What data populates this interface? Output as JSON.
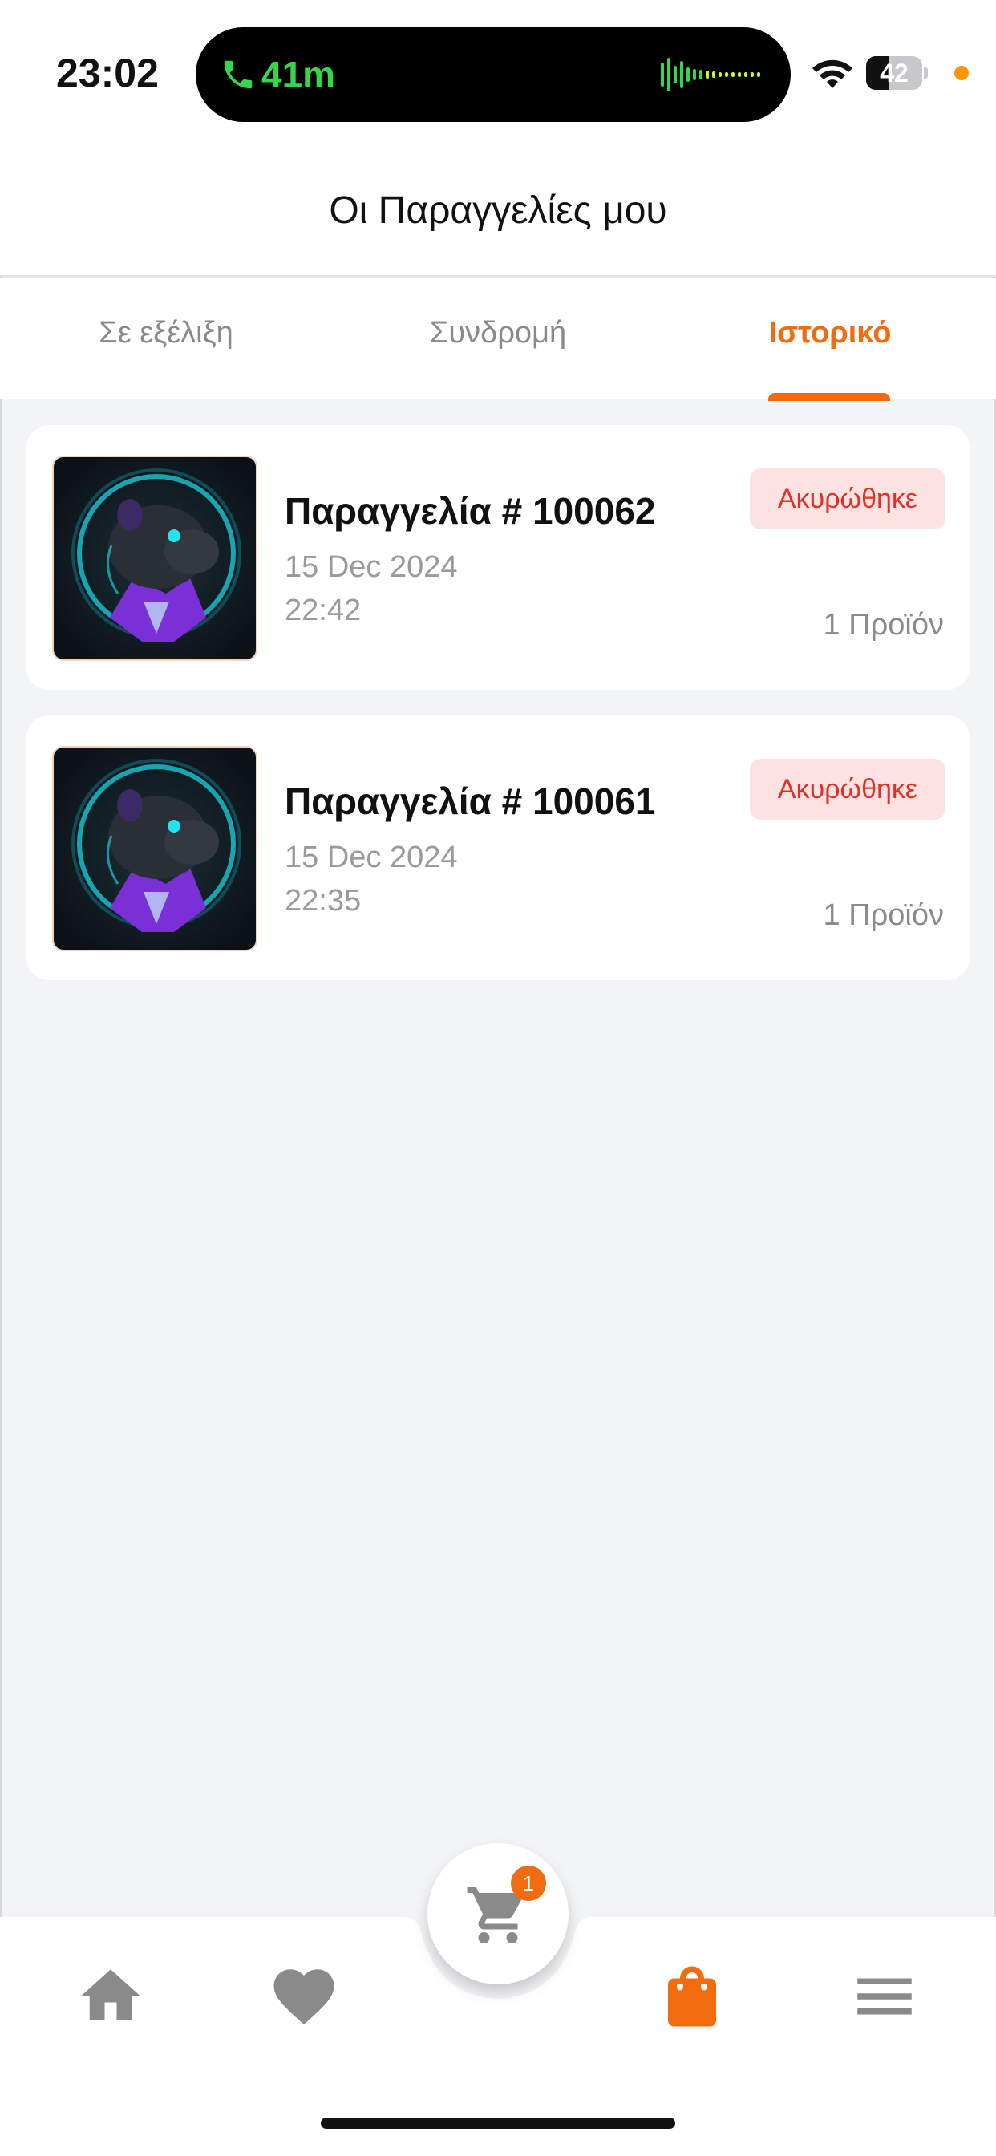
{
  "status_bar": {
    "time": "23:02",
    "call_duration": "41m",
    "battery_level": "42",
    "battery_fraction": 0.42,
    "icons": [
      "phone-icon",
      "waveform-icon",
      "wifi-icon",
      "battery-icon",
      "privacy-dot"
    ]
  },
  "header": {
    "title": "Οι Παραγγελίες μου"
  },
  "tabs": [
    {
      "label": "Σε εξέλιξη",
      "active": false
    },
    {
      "label": "Συνδρομή",
      "active": false
    },
    {
      "label": "Ιστορικό",
      "active": true
    }
  ],
  "orders": [
    {
      "title": "Παραγγελία # 100062",
      "date": "15 Dec 2024",
      "time": "22:42",
      "status": "Ακυρώθηκε",
      "items": "1 Προϊόν",
      "image": "capybara-product-image"
    },
    {
      "title": "Παραγγελία # 100061",
      "date": "15 Dec 2024",
      "time": "22:35",
      "status": "Ακυρώθηκε",
      "items": "1 Προϊόν",
      "image": "capybara-product-image"
    }
  ],
  "bottom_nav": {
    "cart_badge": "1",
    "items": [
      {
        "icon": "home-icon",
        "active": false
      },
      {
        "icon": "heart-icon",
        "active": false
      },
      {
        "icon": "cart-icon",
        "active": false
      },
      {
        "icon": "shopping-bag-icon",
        "active": true
      },
      {
        "icon": "menu-icon",
        "active": false
      }
    ]
  },
  "colors": {
    "accent": "#f26b0f",
    "cancelled_text": "#e0302a",
    "cancelled_bg": "#fde2e2",
    "page_bg": "#f3f4f6",
    "call_green": "#33d74b"
  }
}
